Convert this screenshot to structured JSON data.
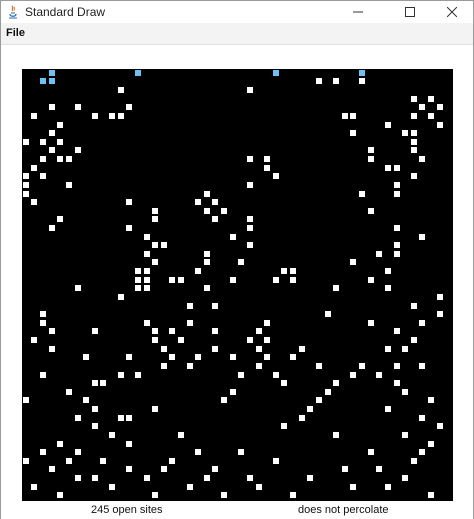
{
  "window": {
    "title": "Standard Draw"
  },
  "menu": {
    "file_label": "File"
  },
  "status": {
    "open_sites": "245 open sites",
    "percolation": "does not percolate"
  },
  "grid": {
    "n": 50,
    "colors": {
      "blocked": "#000000",
      "open": "#ffffff",
      "full": "#6ec1f4"
    }
  }
}
